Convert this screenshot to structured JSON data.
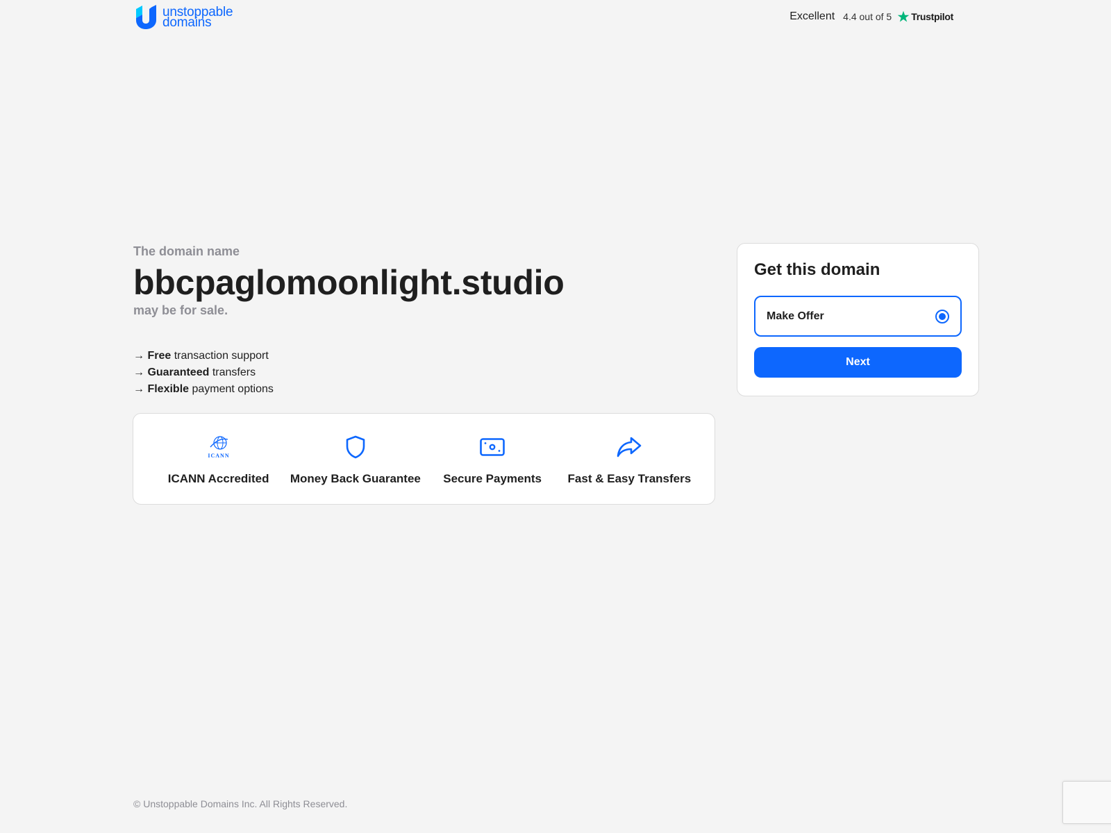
{
  "header": {
    "logo_line1": "unstoppable",
    "logo_line2": "domains",
    "rating_label": "Excellent",
    "rating_score": "4.4 out of 5",
    "rating_brand": "Trustpilot"
  },
  "intro": {
    "pre": "The domain name",
    "domain": "bbcpaglomoonlight.studio",
    "post": "may be for sale."
  },
  "features": [
    {
      "arrow": "→",
      "bold": "Free",
      "rest": " transaction support"
    },
    {
      "arrow": "→",
      "bold": "Guaranteed",
      "rest": " transfers"
    },
    {
      "arrow": "→",
      "bold": "Flexible",
      "rest": " payment options"
    }
  ],
  "trust": [
    {
      "icon": "icann-globe-icon",
      "label": "ICANN Accredited",
      "icon_text": "ICANN"
    },
    {
      "icon": "shield-icon",
      "label": "Money Back Guarantee"
    },
    {
      "icon": "cash-icon",
      "label": "Secure Payments"
    },
    {
      "icon": "share-arrow-icon",
      "label": "Fast & Easy Transfers"
    }
  ],
  "card": {
    "title": "Get this domain",
    "option_label": "Make Offer",
    "option_selected": true,
    "next_label": "Next"
  },
  "footer": {
    "copyright": "© Unstoppable Domains Inc. All Rights Reserved."
  },
  "colors": {
    "brand_blue": "#0d67fe",
    "trustpilot_green": "#00b67a",
    "muted_text": "#8e8e95",
    "background": "#f4f4f4"
  }
}
